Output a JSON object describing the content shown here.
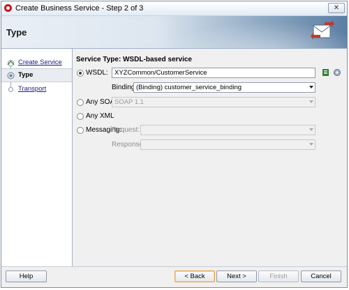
{
  "window": {
    "title": "Create Business Service - Step 2 of 3"
  },
  "header": {
    "title": "Type"
  },
  "nav": {
    "items": [
      {
        "label": "Create Service"
      },
      {
        "label": "Type"
      },
      {
        "label": "Transport"
      }
    ]
  },
  "form": {
    "service_type": "Service Type: WSDL-based service",
    "wsdl": {
      "label": "WSDL:",
      "value": "XYZCommon/CustomerService"
    },
    "binding": {
      "label": "Binding:",
      "value": "(Binding) customer_service_binding"
    },
    "any_soap": {
      "label": "Any SOAP:",
      "value": "SOAP 1.1"
    },
    "any_xml": {
      "label": "Any XML"
    },
    "messaging": {
      "label": "Messaging:"
    },
    "request": {
      "label": "Request:",
      "value": ""
    },
    "response": {
      "label": "Response:",
      "value": ""
    }
  },
  "buttons": {
    "help": "Help",
    "back": "< Back",
    "next": "Next >",
    "finish": "Finish",
    "cancel": "Cancel"
  }
}
